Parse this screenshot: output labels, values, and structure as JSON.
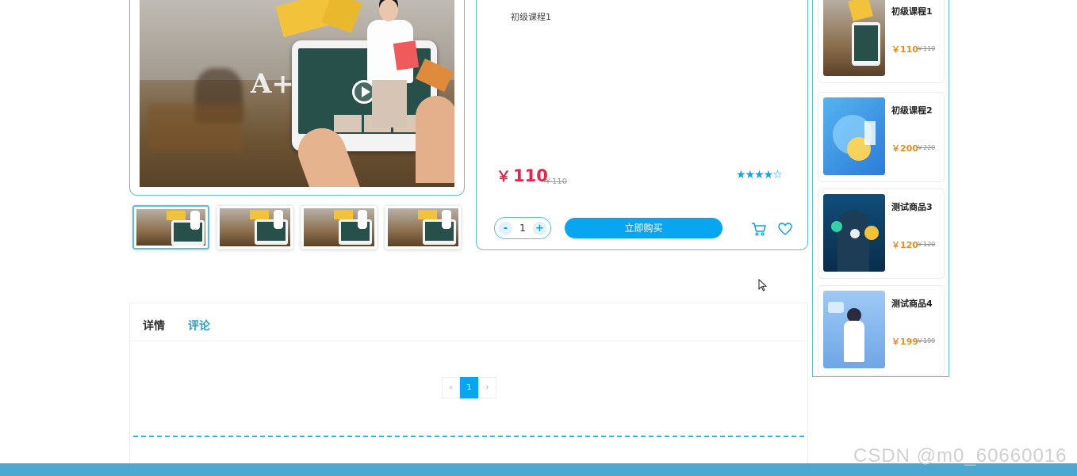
{
  "product": {
    "name": "初级课程1",
    "price_currency": "￥",
    "price": "110",
    "old_price": "￥110",
    "rating_stars": "★★★★☆",
    "quantity": "1",
    "decrement_label": "-",
    "increment_label": "+",
    "buy_label": "立即购买"
  },
  "recommendations": [
    {
      "title": "初级课程1",
      "price": "￥110",
      "old_price": "￥110"
    },
    {
      "title": "初级课程2",
      "price": "￥200",
      "old_price": "￥220"
    },
    {
      "title": "测试商品3",
      "price": "￥120",
      "old_price": "￥120"
    },
    {
      "title": "测试商品4",
      "price": "￥199",
      "old_price": "￥199"
    }
  ],
  "tabs": [
    {
      "label": "详情"
    },
    {
      "label": "评论"
    }
  ],
  "pagination": {
    "prev": "‹",
    "current": "1",
    "next": "›"
  },
  "watermark": "CSDN @m0_60660016",
  "colors": {
    "accent": "#08a6f0",
    "price_red": "#e8224a",
    "rec_price_orange": "#f08c14",
    "border_blue": "#5bc0de",
    "footer": "#4aa8d3"
  }
}
